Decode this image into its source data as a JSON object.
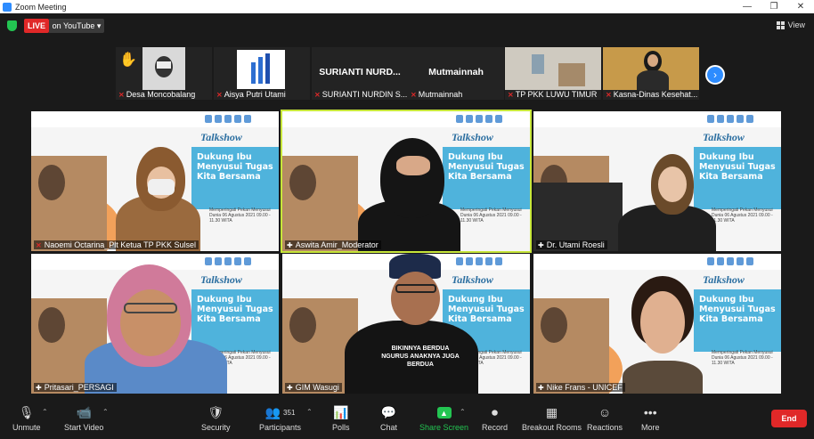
{
  "window": {
    "title": "Zoom Meeting",
    "minimize": "—",
    "restore": "❐",
    "close": "✕"
  },
  "topbar": {
    "live_label": "LIVE",
    "stream_label": "on YouTube ▾",
    "view_label": "View"
  },
  "thumbnails": [
    {
      "name": "Desa Moncobalang",
      "big": ""
    },
    {
      "name": "Aisya Putri Utami",
      "big": ""
    },
    {
      "name": "SURIANTI NURDIN S...",
      "big": "SURIANTI NURD..."
    },
    {
      "name": "Mutmainnah",
      "big": "Mutmainnah"
    },
    {
      "name": "TP PKK LUWU TIMUR",
      "big": ""
    },
    {
      "name": "Kasna-Dinas Kesehat...",
      "big": ""
    }
  ],
  "poster": {
    "title": "Talkshow",
    "subtitle": "Dukung Ibu Menyusui Tugas Kita Bersama",
    "footer": "Memperingati Pekan Menyusui Dunia  06 Agustus 2021  09.00 - 11.30 WITA"
  },
  "tiles": [
    {
      "name": "Naoemi Octarina_Plt Ketua TP PKK Sulsel"
    },
    {
      "name": "Aswita Amir_Moderator"
    },
    {
      "name": "Dr. Utami Roesli"
    },
    {
      "name": "Pritasari_PERSAGI"
    },
    {
      "name": "GIM Wasugi"
    },
    {
      "name": "Nike Frans - UNICEF"
    }
  ],
  "shirt_text": "BIKINNYA BERDUA NGURUS ANAKNYA JUGA BERDUA",
  "toolbar": {
    "unmute": "Unmute",
    "start_video": "Start Video",
    "security": "Security",
    "participants": "Participants",
    "participants_count": "351",
    "polls": "Polls",
    "chat": "Chat",
    "share_screen": "Share Screen",
    "record": "Record",
    "breakout": "Breakout Rooms",
    "reactions": "Reactions",
    "more": "More",
    "end": "End"
  },
  "colors": {
    "accent": "#2d8cff",
    "live_red": "#e02828",
    "share_green": "#23c552",
    "active_speaker": "#c7e63a"
  }
}
